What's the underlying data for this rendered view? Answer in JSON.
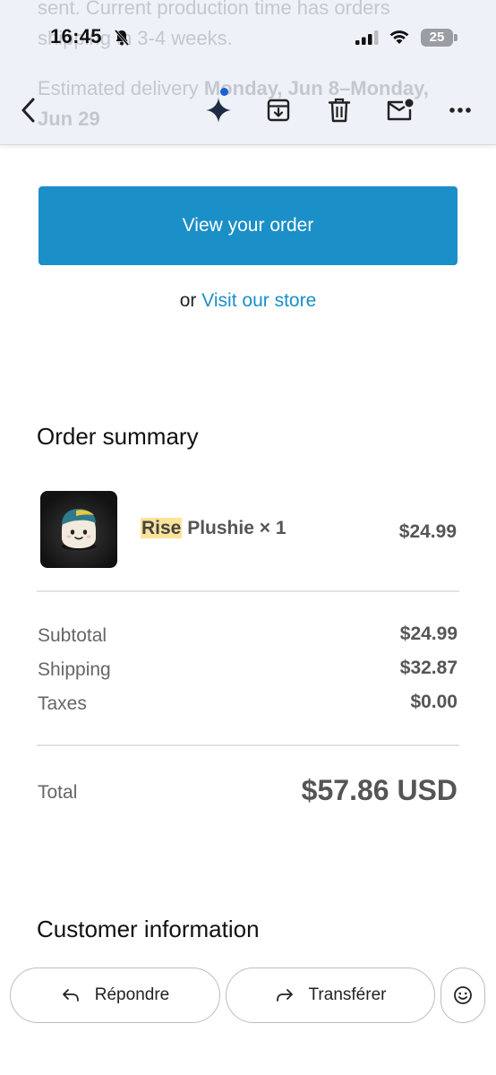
{
  "status_bar": {
    "time": "16:45",
    "battery": "25"
  },
  "background_text": {
    "line1": "sent. Current production time has orders",
    "line2": "shipping in 3-4 weeks.",
    "line3_prefix": "Estimated delivery ",
    "line3_bold": "Monday, Jun 8–Monday,",
    "line4_bold": "Jun 29"
  },
  "toolbar": {
    "icons": [
      "back-chevron-icon",
      "sparkle-icon",
      "archive-icon",
      "trash-icon",
      "mark-unread-icon",
      "more-icon"
    ],
    "sparkle_dot_color": "#1a5fd6"
  },
  "email": {
    "view_order_label": "View your order",
    "or_text": "or",
    "visit_store_label": "Visit our store",
    "order_summary_heading": "Order summary",
    "item": {
      "name_highlight": "Rise",
      "name_rest": "Plushie × 1",
      "price": "$24.99"
    },
    "subtotal_label": "Subtotal",
    "subtotal_value": "$24.99",
    "shipping_label": "Shipping",
    "shipping_value": "$32.87",
    "taxes_label": "Taxes",
    "taxes_value": "$0.00",
    "total_label": "Total",
    "total_value": "$57.86 USD",
    "customer_info_heading": "Customer information"
  },
  "reply_bar": {
    "reply_label": "Répondre",
    "forward_label": "Transférer"
  },
  "colors": {
    "accent": "#1a8fc8",
    "highlight": "#fbe39a"
  }
}
